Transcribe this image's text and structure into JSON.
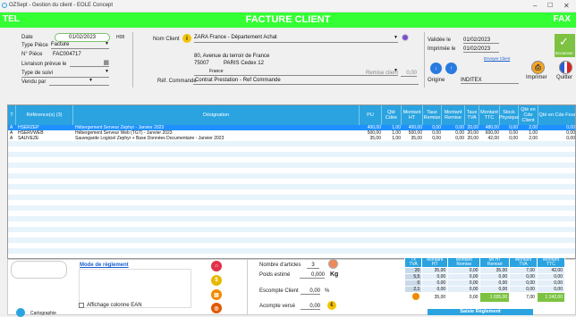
{
  "window": {
    "title": "OZSept - Gestion du client - EOLE Concept",
    "min": "–",
    "max": "☐",
    "close": "✕"
  },
  "banner": {
    "left": "TEL",
    "center": "FACTURE CLIENT",
    "right": "FAX"
  },
  "header": {
    "date_label": "Date",
    "date_value": "01/02/2023",
    "hour_label": "H08",
    "type_piece_label": "Type Pièce",
    "type_piece_value": "Facture",
    "num_piece_label": "N° Pièce",
    "num_piece_value": "FAC004717",
    "livraison_label": "Livraison prévue le",
    "type_suivi_label": "Type de suivi",
    "vendu_par_label": "Vendu par",
    "nom_client_label": "Nom Client",
    "nom_client_value": "ZARA France - Département Achat",
    "address_line1": "80, Avenue du terroir de France",
    "postcode": "75007",
    "city": "PARIS Cedex 12",
    "country": "France",
    "remise_label": "Remise client",
    "remise_value": "0,00",
    "ref_commande_label": "Réf. Commande",
    "ref_commande_value": "Contrat Prestation - Ref Commande",
    "validee_label": "Validée le",
    "validee_value": "01/02/2023",
    "imprimee_label": "Imprimée le",
    "imprimee_value": "01/02/2023",
    "envoyer_client": "Envoyer Client",
    "origine_label": "Origine",
    "origine_value": "INDITEX",
    "encaisser_label": "Encaisser",
    "imprimer_label": "Imprimer",
    "quitter_label": "Quitter"
  },
  "table": {
    "columns": [
      "T",
      "Référence(s) (3)",
      "Désignation",
      "PU",
      "Qté Cdée",
      "Montant HT",
      "Taux Remise",
      "Montant Remise",
      "Taux TVA",
      "Montant TTC",
      "Stock Physique",
      "Qté en Cde Client",
      "Qté en Cde Four"
    ],
    "rows": [
      {
        "t": "A",
        "ref": "HSERZEP",
        "des": "Hébergement Serveur Zephyr - Janvier 2023",
        "pu": "400,00",
        "qte": "1,00",
        "ht": "400,00",
        "taux_rem": "0,00",
        "mt_rem": "0,00",
        "tva": "20,00",
        "ttc": "480,00",
        "stock": "0,00",
        "cde_cli": "2,00",
        "cde_four": "0,00"
      },
      {
        "t": "A",
        "ref": "HSERVWEB",
        "des": "Hébergement Serveur Web (TGT) - Janvier 2023",
        "pu": "500,00",
        "qte": "1,00",
        "ht": "500,00",
        "taux_rem": "0,00",
        "mt_rem": "0,00",
        "tva": "20,00",
        "ttc": "600,00",
        "stock": "0,00",
        "cde_cli": "1,00",
        "cde_four": "0,00"
      },
      {
        "t": "A",
        "ref": "SAUVEZE",
        "des": "Sauvegarde Logiciel Zephyr + Base Données Documentaire - Janvier 2023",
        "pu": "35,00",
        "qte": "1,00",
        "ht": "35,00",
        "taux_rem": "0,00",
        "mt_rem": "0,00",
        "tva": "20,00",
        "ttc": "42,00",
        "stock": "0,00",
        "cde_cli": "2,00",
        "cde_four": "0,00"
      }
    ]
  },
  "footer": {
    "mode_reglement": "Mode de règlement",
    "affichage_ean": "Affichage colonne EAN",
    "cartographie": "Cartographie",
    "nb_articles_label": "Nombre d'articles",
    "nb_articles_value": "3",
    "poids_label": "Poids estimé",
    "poids_value": "0,000",
    "poids_unit": "Kg",
    "escompte_label": "Escompte Client",
    "escompte_value": "0,00",
    "escompte_unit": "%",
    "acompte_label": "Acompte versé",
    "acompte_value": "0,00",
    "saisie_reglement": "Saisie Règlement"
  },
  "tva_table": {
    "headers": [
      "Tx TVA",
      "Montant HT",
      "Montant Remise",
      "Mt HT Remisé",
      "Montant TVA",
      "Montant TTC"
    ],
    "rows": [
      [
        "20",
        "35,00",
        "0,00",
        "35,00",
        "7,00",
        "42,00"
      ],
      [
        "5,5",
        "0,00",
        "0,00",
        "0,00",
        "0,00",
        "0,00"
      ],
      [
        "0",
        "0,00",
        "0,00",
        "0,00",
        "0,00",
        "0,00"
      ],
      [
        "2,1",
        "0,00",
        "0,00",
        "0,00",
        "0,00",
        "0,00"
      ]
    ],
    "totals": [
      "35,00",
      "0,00",
      "1 035,00",
      "7,00",
      "1 242,00"
    ]
  },
  "colors": {
    "green": "#33ff33",
    "blue": "#2aa3e0",
    "selected": "#1e90ff"
  }
}
